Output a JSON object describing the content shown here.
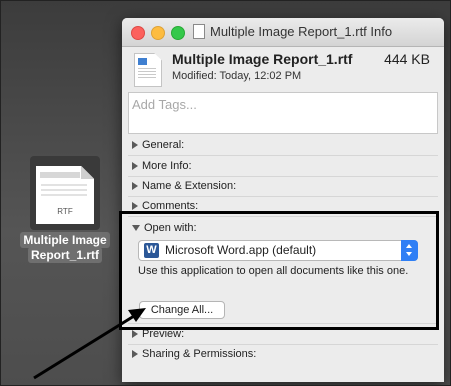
{
  "desktop_icon": {
    "extension": "RTF",
    "label_line1": "Multiple Image",
    "label_line2": "Report_1.rtf"
  },
  "window": {
    "title": "Multiple Image Report_1.rtf Info"
  },
  "header": {
    "file_name": "Multiple Image Report_1.rtf",
    "size": "444 KB",
    "modified": "Modified: Today, 12:02 PM"
  },
  "tags": {
    "placeholder": "Add Tags..."
  },
  "sections": {
    "general": "General:",
    "more_info": "More Info:",
    "name_extension": "Name & Extension:",
    "comments": "Comments:",
    "open_with": "Open with:",
    "preview": "Preview:",
    "sharing": "Sharing & Permissions:"
  },
  "open_with": {
    "app_icon_letter": "W",
    "selected_app": "Microsoft Word.app (default)",
    "description": "Use this application to open all documents like this one.",
    "change_all_label": "Change All..."
  },
  "colors": {
    "close": "#fc615d",
    "minimize": "#fdbc40",
    "maximize": "#34c84a",
    "popup_accent": "#2f7ff5",
    "word_blue": "#2b5797"
  }
}
